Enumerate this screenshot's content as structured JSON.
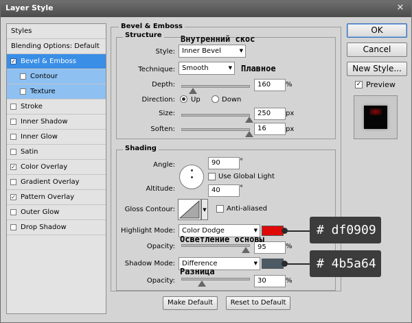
{
  "window": {
    "title": "Layer Style",
    "close_glyph": "✕"
  },
  "sidebar": {
    "items": [
      {
        "label": "Styles",
        "checkbox": false,
        "checked": false,
        "state": "header"
      },
      {
        "label": "Blending Options: Default",
        "checkbox": false,
        "checked": false,
        "state": "normal"
      },
      {
        "label": "Bevel & Emboss",
        "checkbox": true,
        "checked": true,
        "state": "selected"
      },
      {
        "label": "Contour",
        "checkbox": true,
        "checked": false,
        "state": "sub"
      },
      {
        "label": "Texture",
        "checkbox": true,
        "checked": false,
        "state": "sub"
      },
      {
        "label": "Stroke",
        "checkbox": true,
        "checked": false,
        "state": "normal"
      },
      {
        "label": "Inner Shadow",
        "checkbox": true,
        "checked": false,
        "state": "normal"
      },
      {
        "label": "Inner Glow",
        "checkbox": true,
        "checked": false,
        "state": "normal"
      },
      {
        "label": "Satin",
        "checkbox": true,
        "checked": false,
        "state": "normal"
      },
      {
        "label": "Color Overlay",
        "checkbox": true,
        "checked": true,
        "state": "normal"
      },
      {
        "label": "Gradient Overlay",
        "checkbox": true,
        "checked": false,
        "state": "normal"
      },
      {
        "label": "Pattern Overlay",
        "checkbox": true,
        "checked": true,
        "state": "normal"
      },
      {
        "label": "Outer Glow",
        "checkbox": true,
        "checked": false,
        "state": "normal"
      },
      {
        "label": "Drop Shadow",
        "checkbox": true,
        "checked": false,
        "state": "normal"
      }
    ]
  },
  "bevel": {
    "section_title": "Bevel & Emboss",
    "structure": {
      "title": "Structure",
      "style_label": "Style:",
      "style_value": "Inner Bevel",
      "technique_label": "Technique:",
      "technique_value": "Smooth",
      "depth_label": "Depth:",
      "depth_value": "160",
      "depth_unit": "%",
      "depth_level": 0.16,
      "direction_label": "Direction:",
      "direction_up": "Up",
      "direction_down": "Down",
      "direction_selected": "Up",
      "size_label": "Size:",
      "size_value": "250",
      "size_unit": "px",
      "size_level": 1.0,
      "soften_label": "Soften:",
      "soften_value": "16",
      "soften_unit": "px",
      "soften_level": 1.0
    },
    "shading": {
      "title": "Shading",
      "angle_label": "Angle:",
      "angle_value": "90",
      "angle_unit": "°",
      "global_light_label": "Use Global Light",
      "global_light_checked": false,
      "altitude_label": "Altitude:",
      "altitude_value": "40",
      "altitude_unit": "°",
      "gloss_label": "Gloss Contour:",
      "anti_aliased_label": "Anti-aliased",
      "anti_aliased_checked": false,
      "highlight_mode_label": "Highlight Mode:",
      "highlight_mode_value": "Color Dodge",
      "highlight_color": "#df0909",
      "highlight_opacity_label": "Opacity:",
      "highlight_opacity_value": "95",
      "highlight_opacity_unit": "%",
      "highlight_opacity_level": 0.95,
      "shadow_mode_label": "Shadow Mode:",
      "shadow_mode_value": "Difference",
      "shadow_color": "#4b5a64",
      "shadow_opacity_label": "Opacity:",
      "shadow_opacity_value": "30",
      "shadow_opacity_unit": "%",
      "shadow_opacity_level": 0.3
    },
    "make_default_label": "Make Default",
    "reset_default_label": "Reset to Default"
  },
  "annotations": {
    "inner_bevel_ru": "Внутренний скос",
    "smooth_ru": "Плавное",
    "color_dodge_ru": "Осветление основы",
    "difference_ru": "Разница",
    "highlight_hex": "# df0909",
    "shadow_hex": "# 4b5a64"
  },
  "actions": {
    "ok_label": "OK",
    "cancel_label": "Cancel",
    "new_style_label": "New Style...",
    "preview_label": "Preview",
    "preview_checked": true
  }
}
